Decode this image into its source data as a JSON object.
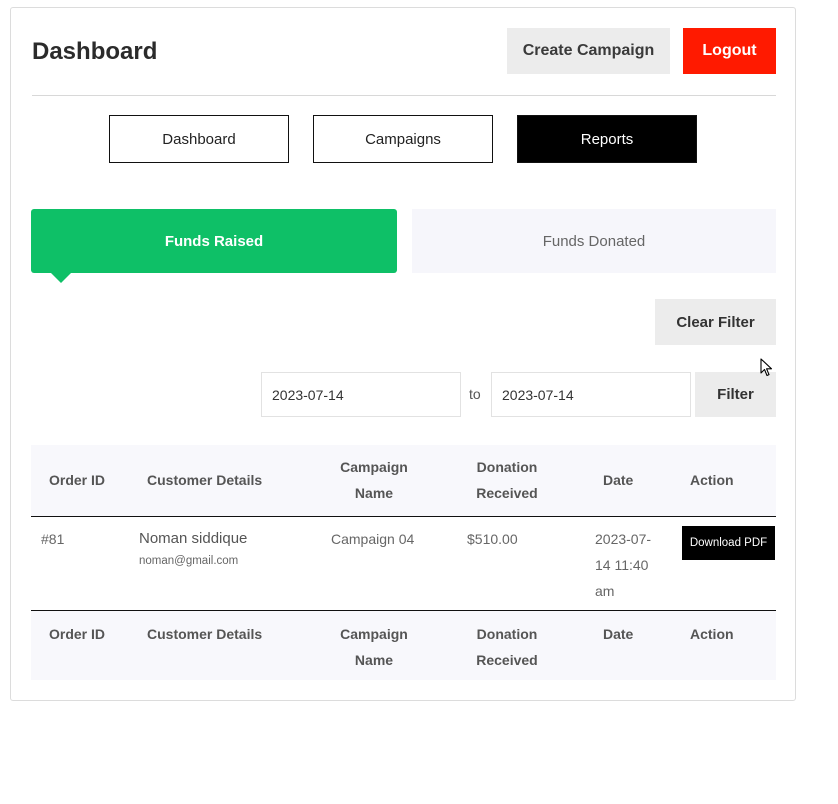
{
  "header": {
    "title": "Dashboard",
    "create_label": "Create Campaign",
    "logout_label": "Logout"
  },
  "nav": [
    {
      "label": "Dashboard",
      "active": false
    },
    {
      "label": "Campaigns",
      "active": false
    },
    {
      "label": "Reports",
      "active": true
    }
  ],
  "tabs": {
    "raised": "Funds Raised",
    "donated": "Funds Donated"
  },
  "filter": {
    "clear_label": "Clear Filter",
    "from_value": "2023-07-14",
    "to_label": "to",
    "to_value": "2023-07-14",
    "filter_label": "Filter"
  },
  "table": {
    "columns": {
      "order_id": "Order ID",
      "customer": "Customer Details",
      "campaign_1": "Campaign",
      "campaign_2": "Name",
      "donation_1": "Donation",
      "donation_2": "Received",
      "date": "Date",
      "action": "Action"
    },
    "rows": [
      {
        "order_id": "#81",
        "customer_name": "Noman siddique",
        "customer_email": "noman@gmail.com",
        "campaign": "Campaign 04",
        "amount": "$510.00",
        "date_1": "2023-07-",
        "date_2": "14 11:40",
        "date_3": "am",
        "action_label": "Download PDF"
      }
    ]
  },
  "colors": {
    "accent_green": "#0ec067",
    "logout_red": "#ff1a00"
  }
}
